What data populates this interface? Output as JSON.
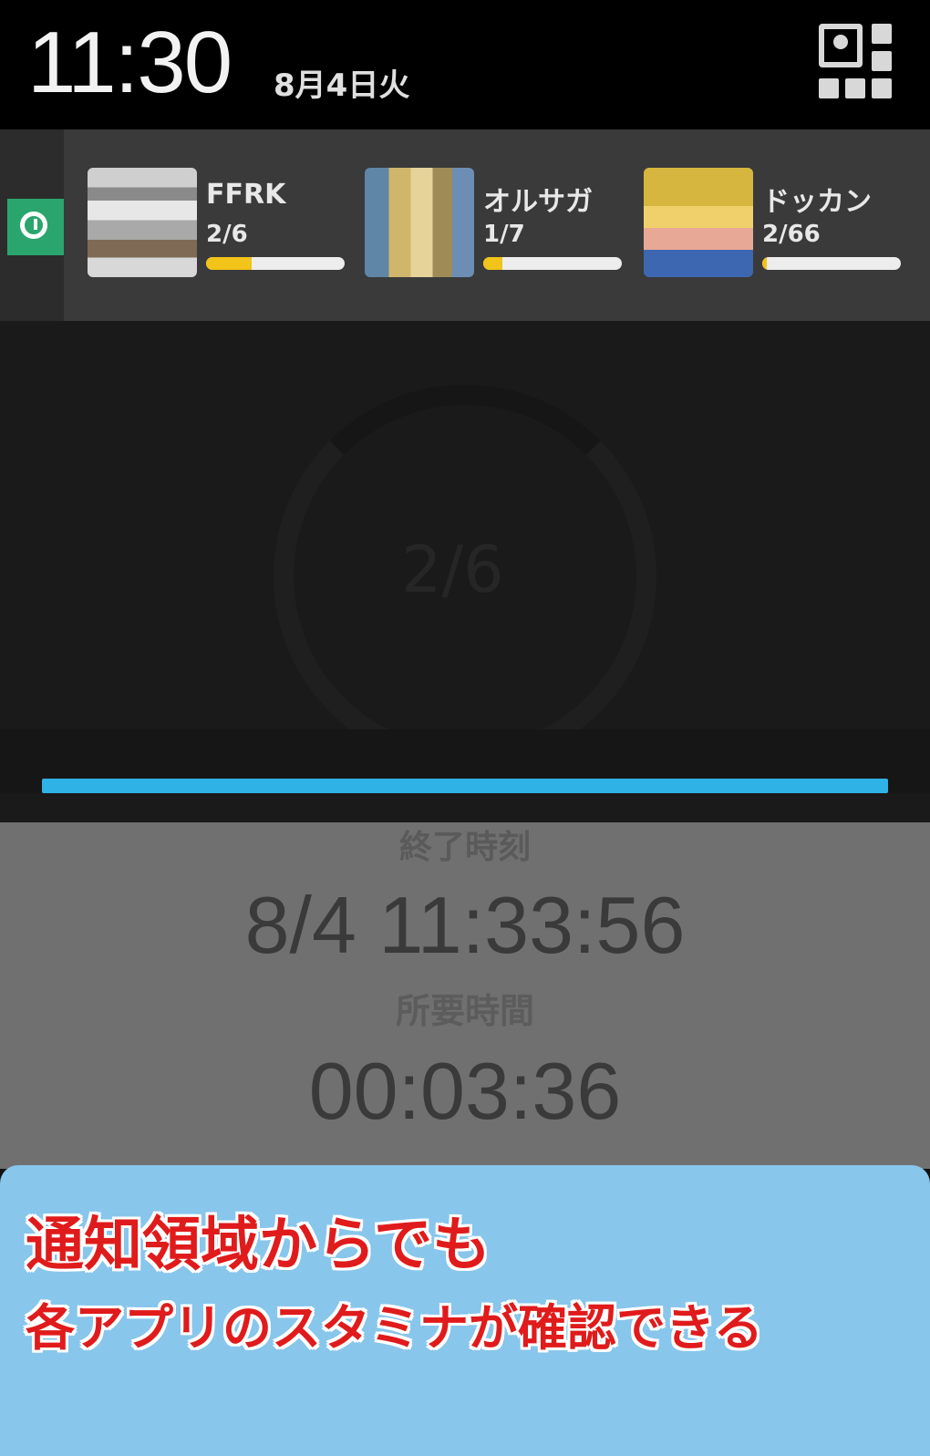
{
  "status_bar": {
    "time": "11:30",
    "date": "8月4日火"
  },
  "notification": {
    "apps": [
      {
        "name": "FFRK",
        "count": "2/6",
        "progress": 0.33,
        "icon": "ffrk-app-icon"
      },
      {
        "name": "オルサガ",
        "count": "1/7",
        "progress": 0.14,
        "icon": "orusaga-app-icon"
      },
      {
        "name": "ドッカン",
        "count": "2/66",
        "progress": 0.03,
        "icon": "dokkan-app-icon"
      }
    ]
  },
  "timer": {
    "center_count": "2/6",
    "progress_bar_level": 1.0,
    "end_time_label": "終了時刻",
    "end_time": "8/4 11:33:56",
    "duration_label": "所要時間",
    "duration": "00:03:36"
  },
  "caption": {
    "line1": "通知領域からでも",
    "line2": "各アプリのスタミナが確認できる"
  },
  "colors": {
    "accent_blue": "#2fb2e6",
    "stamina_yellow": "#f2c318",
    "alarm_green": "#2aa56e",
    "caption_bg": "#88c6ec",
    "caption_text": "#e01b1b"
  }
}
